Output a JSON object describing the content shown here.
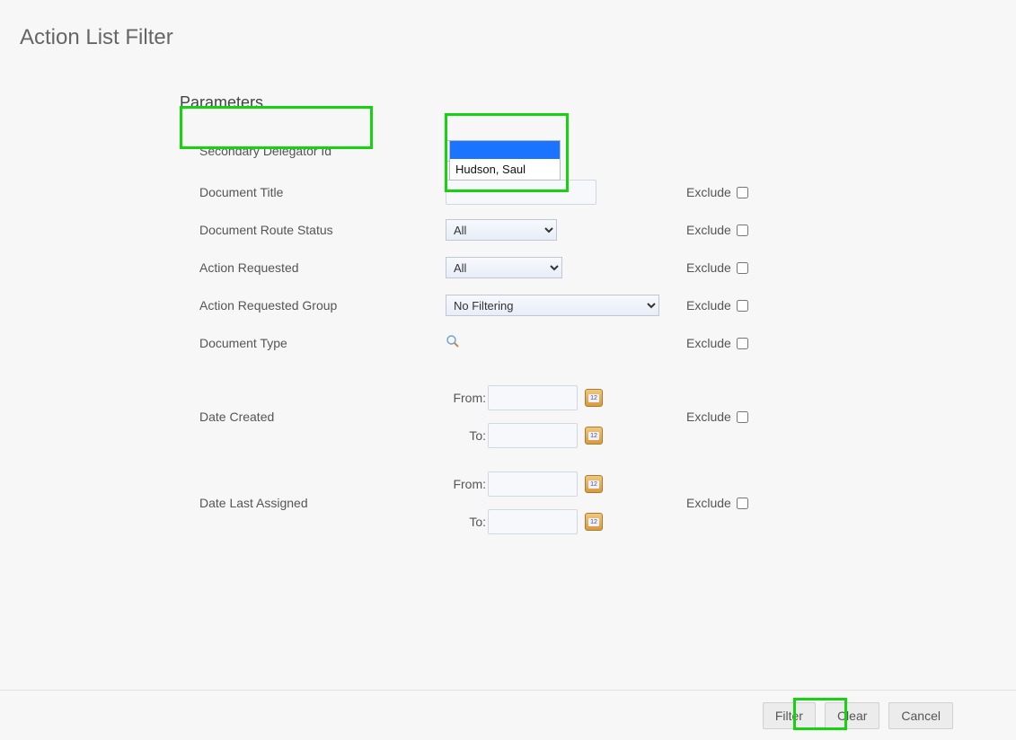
{
  "page_title": "Action List Filter",
  "section_title": "Parameters",
  "labels": {
    "secondary_delegator": "Secondary Delegator Id",
    "document_title": "Document Title",
    "document_route_status": "Document Route Status",
    "action_requested": "Action Requested",
    "action_requested_group": "Action Requested Group",
    "document_type": "Document Type",
    "date_created": "Date Created",
    "date_last_assigned": "Date Last Assigned",
    "from": "From:",
    "to": "To:",
    "exclude": "Exclude"
  },
  "dropdown": {
    "delegator_options": {
      "blank": "",
      "hudson": "Hudson, Saul"
    },
    "route_status_selected": "All",
    "action_requested_selected": "All",
    "action_requested_group_selected": "No Filtering"
  },
  "buttons": {
    "filter": "Filter",
    "clear": "Clear",
    "cancel": "Cancel"
  }
}
